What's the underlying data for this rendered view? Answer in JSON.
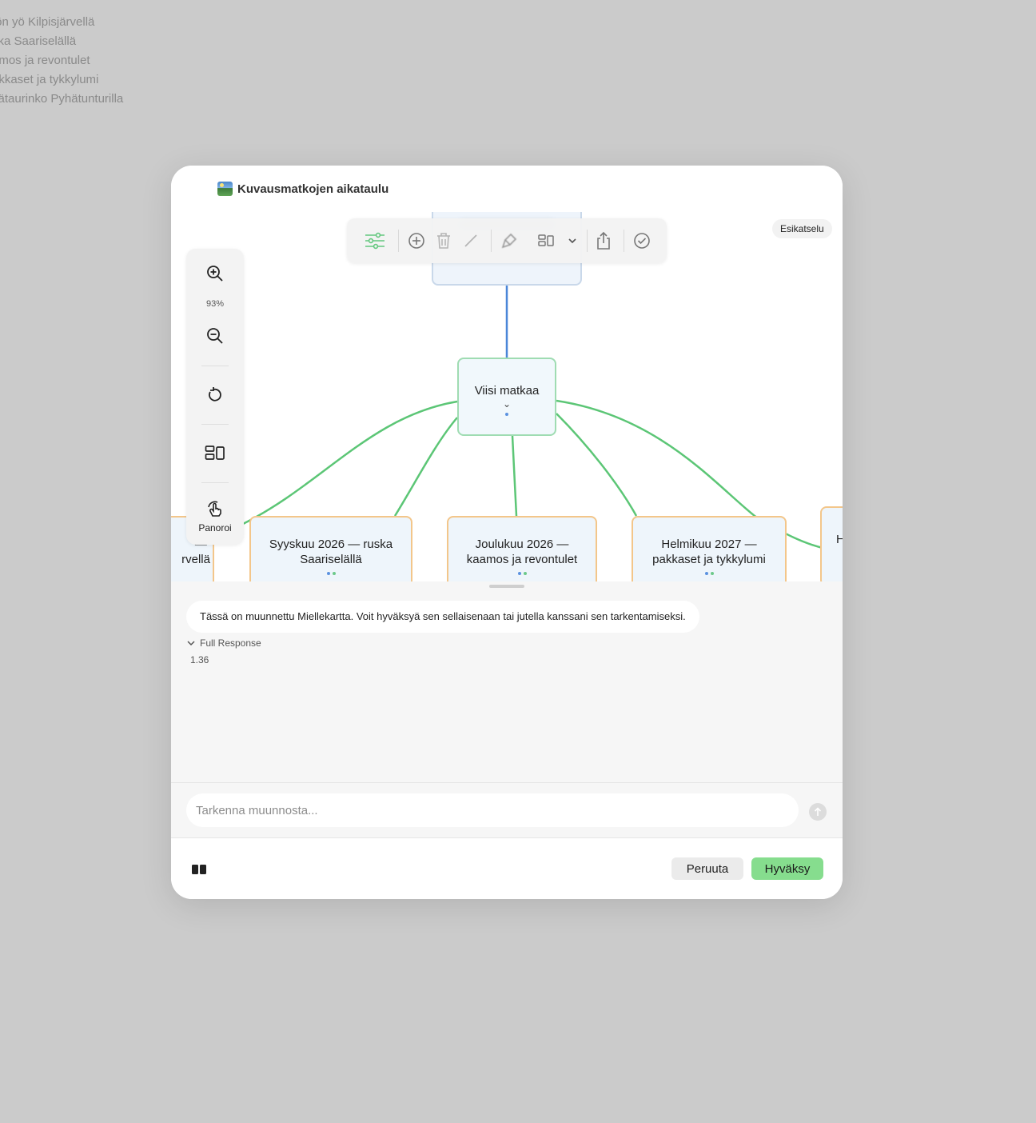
{
  "background_list": [
    "tön yö Kilpisjärvellä",
    "ska Saariselällä",
    "amos ja revontulet",
    "akkaset ja tykkylumi",
    "vätaurinko Pyhätunturilla"
  ],
  "dialog": {
    "title_icon": "map-picture-icon",
    "title": "Kuvausmatkojen aikataulu",
    "preview_label": "Esikatselu"
  },
  "toolbar": {
    "zoom_level": "93%",
    "pan_label": "Panoroi",
    "icons": [
      "sliders-icon",
      "add-circle-icon",
      "trash-icon",
      "line-icon",
      "brush-icon",
      "layout-icon",
      "chevron-down-icon",
      "share-icon",
      "check-circle-icon"
    ],
    "vertical_icons": [
      "zoom-in-icon",
      "zoom-out-icon",
      "reset-icon",
      "layout-icon",
      "pan-hand-icon"
    ]
  },
  "mindmap": {
    "center": {
      "label": "Viisi matkaa"
    },
    "children": [
      {
        "label": "— \nrvellä"
      },
      {
        "label": "Syyskuu 2026 — ruska Saariselällä"
      },
      {
        "label": "Joulukuu 2026 — kaamos ja revontulet"
      },
      {
        "label": "Helmikuu 2027 — pakkaset ja tykkylumi"
      },
      {
        "label": "H"
      }
    ]
  },
  "chat": {
    "message": "Tässä on muunnettu Miellekartta. Voit hyväksyä sen sellaisenaan tai jutella kanssani sen tarkentamiseksi.",
    "full_response_label": "Full Response",
    "version": "1.36",
    "input_placeholder": "Tarkenna muunnosta..."
  },
  "footer": {
    "cancel_label": "Peruuta",
    "accept_label": "Hyväksy"
  },
  "colors": {
    "accent_green": "#86dd8e",
    "edge_green": "#5cc676",
    "edge_blue": "#4a86d8",
    "child_border": "#f3c68a"
  }
}
